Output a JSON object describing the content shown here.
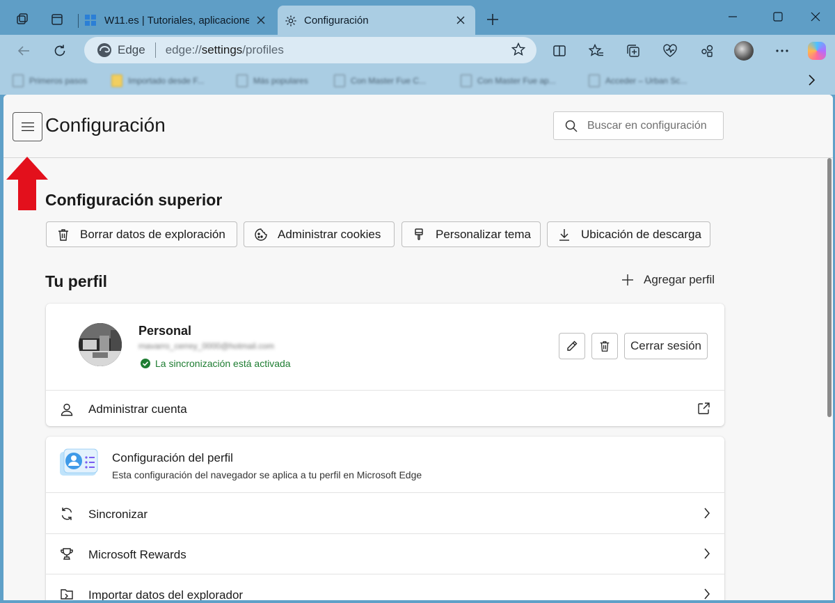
{
  "browser": {
    "tabs": [
      {
        "title": "W11.es | Tutoriales, aplicaciones y",
        "active": false
      },
      {
        "title": "Configuración",
        "active": true
      }
    ],
    "address": {
      "brand": "Edge",
      "url_prefix": "edge://",
      "url_highlight": "settings",
      "url_suffix": "/profiles"
    },
    "favorites": [
      {
        "label": "Primeros pasos",
        "icon": "page"
      },
      {
        "label": "Importado desde F...",
        "icon": "folder"
      },
      {
        "label": "Más populares",
        "icon": "page"
      },
      {
        "label": "Con Master Fue C...",
        "icon": "page"
      },
      {
        "label": "Con Master Fue ap...",
        "icon": "page"
      },
      {
        "label": "Acceder – Urban Sc...",
        "icon": "page"
      }
    ]
  },
  "settings": {
    "title": "Configuración",
    "search_placeholder": "Buscar en configuración",
    "top_section": {
      "title": "Configuración superior",
      "buttons": [
        {
          "label": "Borrar datos de exploración",
          "icon": "trash-icon"
        },
        {
          "label": "Administrar cookies",
          "icon": "cookie-icon"
        },
        {
          "label": "Personalizar tema",
          "icon": "brush-icon"
        },
        {
          "label": "Ubicación de descarga",
          "icon": "download-icon"
        }
      ]
    },
    "profile": {
      "heading": "Tu perfil",
      "add_label": "Agregar perfil",
      "name": "Personal",
      "email": "rnavarro_cerrey_0000@hotmail.com",
      "sync_status": "La sincronización está activada",
      "signout_label": "Cerrar sesión",
      "manage_label": "Administrar cuenta"
    },
    "profile_settings": {
      "title": "Configuración del perfil",
      "description": "Esta configuración del navegador se aplica a tu perfil en Microsoft Edge",
      "rows": [
        {
          "label": "Sincronizar",
          "icon": "sync-icon"
        },
        {
          "label": "Microsoft Rewards",
          "icon": "trophy-icon"
        },
        {
          "label": "Importar datos del explorador",
          "icon": "import-icon"
        }
      ]
    }
  },
  "colors": {
    "tabbar": "#5f9ec6",
    "toolbar": "#aacde3",
    "content_bg": "#f7f7f7",
    "sync_green": "#1e7d32",
    "arrow_red": "#e3101c"
  }
}
